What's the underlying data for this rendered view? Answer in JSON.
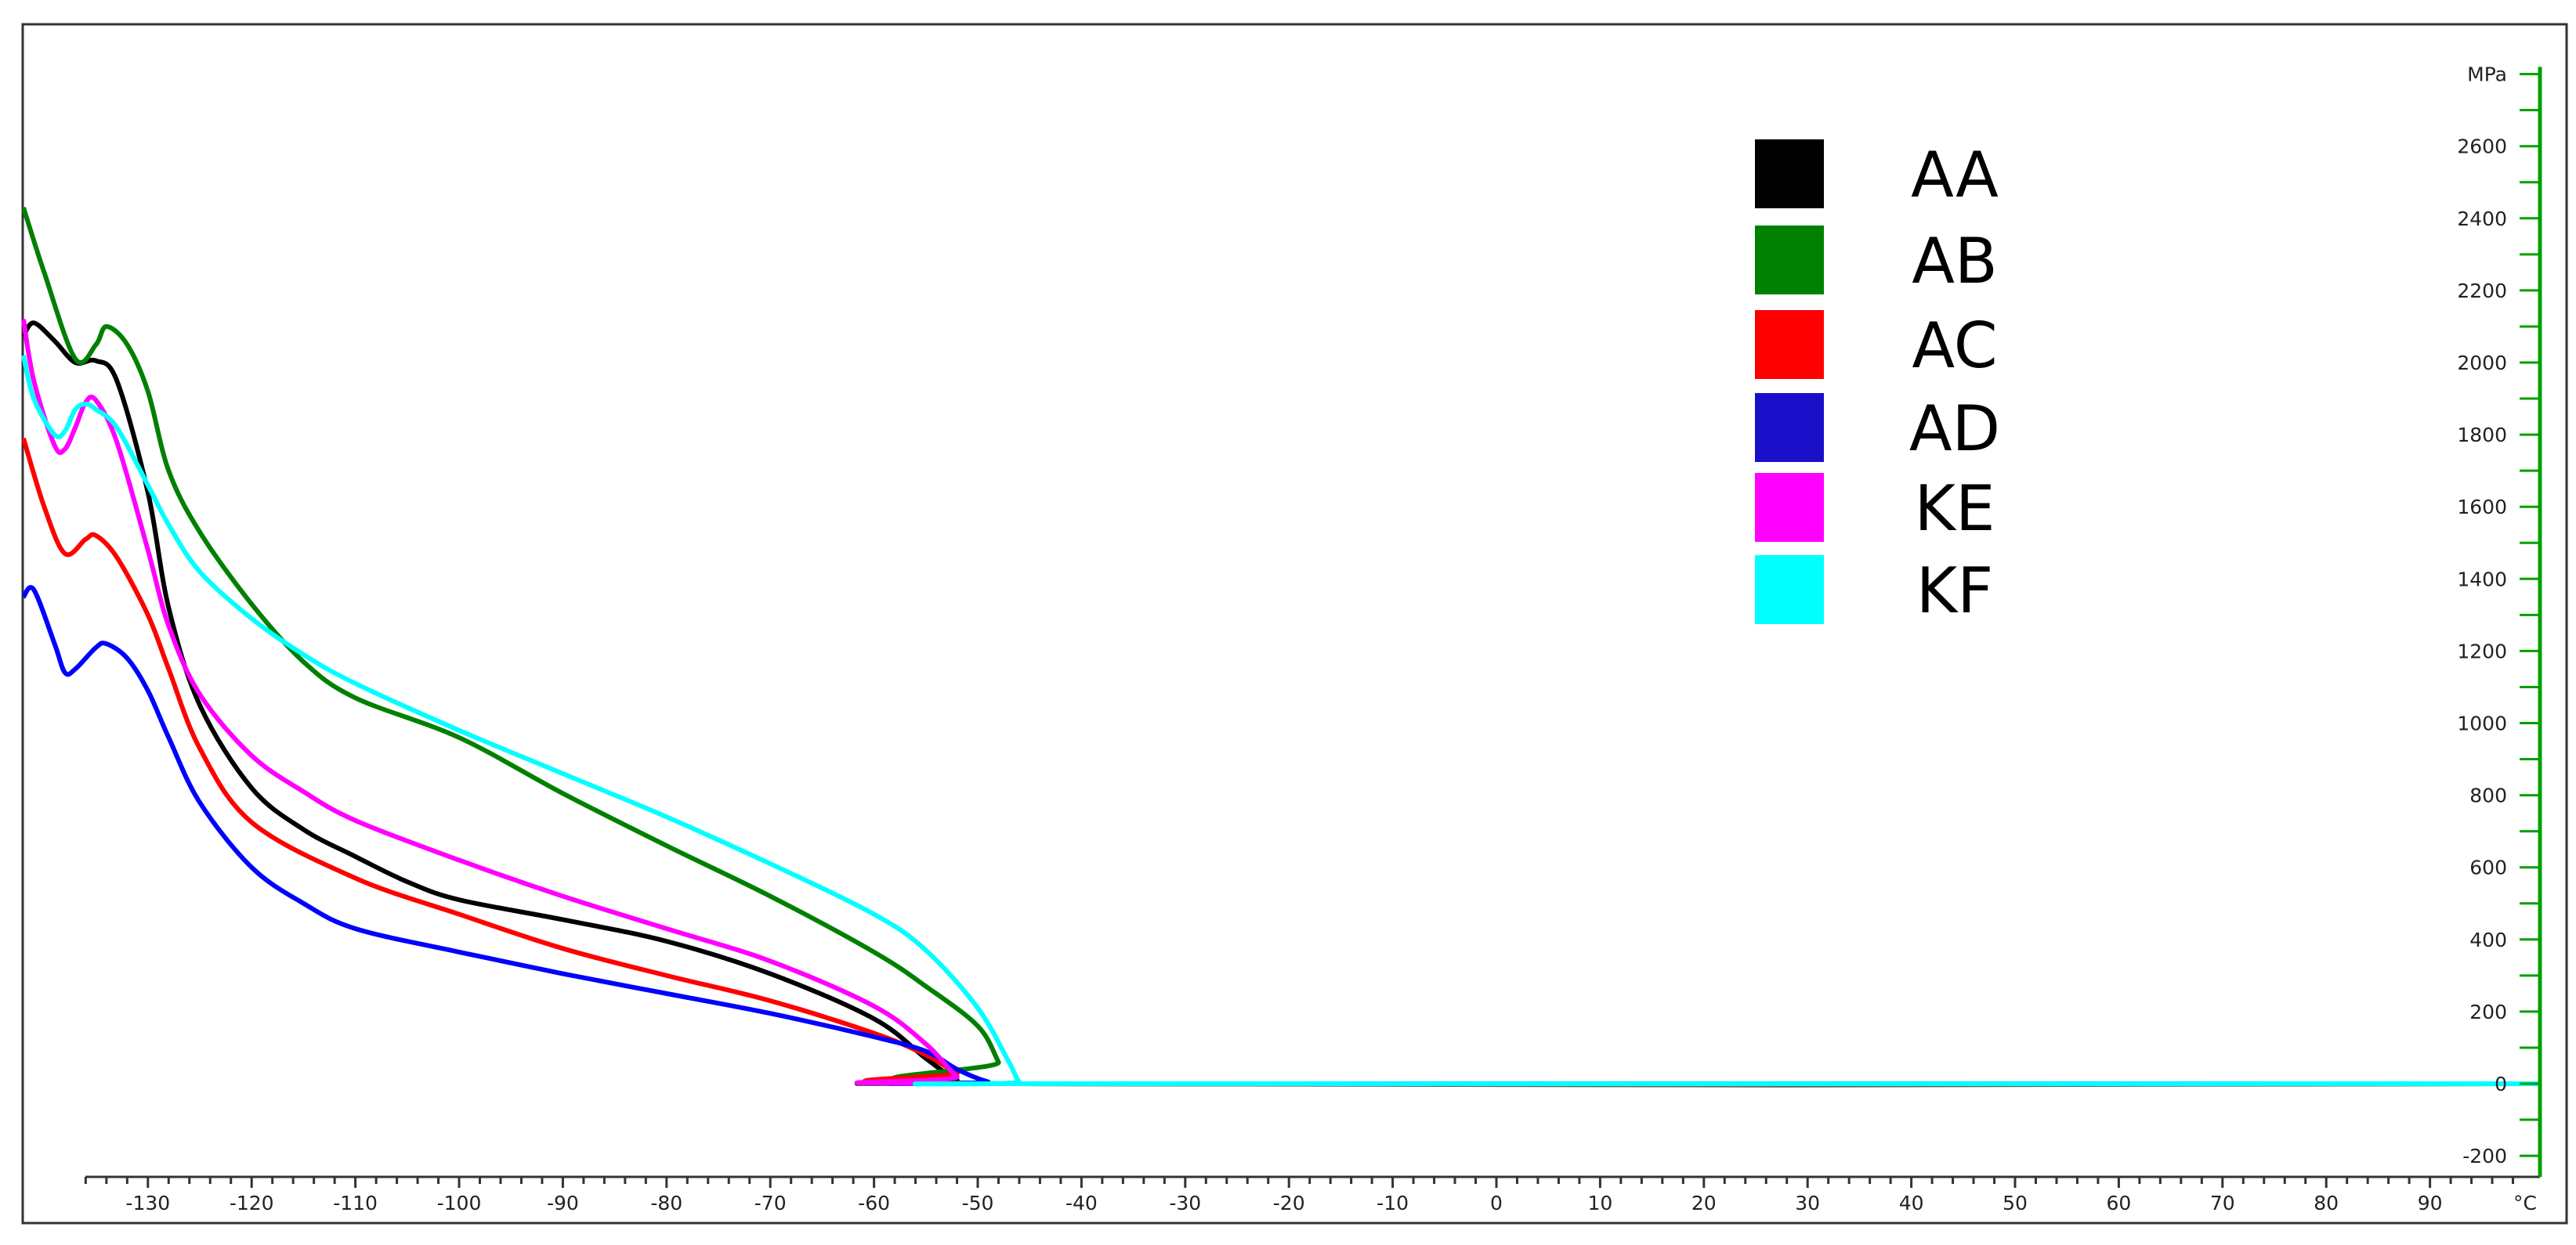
{
  "chart_data": {
    "type": "line",
    "title": "",
    "xlabel": "°C",
    "ylabel": "MPa",
    "xlim": [
      -142,
      100.6
    ],
    "ylim": [
      -250,
      2820
    ],
    "x_ticks": [
      -130,
      -120,
      -110,
      -100,
      -90,
      -80,
      -70,
      -60,
      -50,
      -40,
      -30,
      -20,
      -10,
      0,
      10,
      20,
      30,
      40,
      50,
      60,
      70,
      80,
      90
    ],
    "y_ticks": [
      -200,
      0,
      200,
      400,
      600,
      800,
      1000,
      1200,
      1400,
      1600,
      1800,
      2000,
      2200,
      2400,
      2600
    ],
    "grid": false,
    "legend_position": "top-right",
    "series": [
      {
        "name": "AA",
        "color": "#000000",
        "legend_color": "#000000",
        "x": [
          -142,
          -141,
          -139,
          -137,
          -135,
          -133,
          -130,
          -128,
          -125,
          -120,
          -115,
          -110,
          -105,
          -100,
          -90,
          -80,
          -70,
          -60,
          -55,
          -52,
          -50,
          100.6
        ],
        "y": [
          2073,
          2110,
          2060,
          2000,
          2005,
          1950,
          1640,
          1320,
          1050,
          820,
          705,
          630,
          560,
          510,
          455,
          395,
          305,
          180,
          70,
          10,
          0,
          0
        ]
      },
      {
        "name": "AB",
        "color": "#008000",
        "legend_color": "#008000",
        "x": [
          -142,
          -140,
          -137,
          -135,
          -134,
          -132,
          -130,
          -128,
          -125,
          -120,
          -115,
          -110,
          -100,
          -90,
          -80,
          -70,
          -60,
          -55,
          -50,
          -48,
          -47,
          100.6
        ],
        "y": [
          2430,
          2250,
          2010,
          2050,
          2100,
          2050,
          1920,
          1700,
          1530,
          1330,
          1170,
          1070,
          960,
          805,
          660,
          520,
          365,
          270,
          160,
          60,
          0,
          0
        ]
      },
      {
        "name": "AC",
        "color": "#ff0000",
        "legend_color": "#ff0000",
        "x": [
          -142,
          -140,
          -138,
          -136,
          -135,
          -133,
          -130,
          -128,
          -125,
          -120,
          -110,
          -100,
          -90,
          -80,
          -70,
          -60,
          -55,
          -52,
          -49,
          100.6
        ],
        "y": [
          1790,
          1600,
          1470,
          1510,
          1520,
          1460,
          1300,
          1150,
          930,
          725,
          570,
          470,
          375,
          300,
          230,
          140,
          80,
          30,
          0,
          0
        ]
      },
      {
        "name": "AD",
        "color": "#0000ff",
        "legend_color": "#1a0fc8",
        "x": [
          -142,
          -141,
          -139,
          -138,
          -137,
          -135,
          -134,
          -132,
          -130,
          -128,
          -125,
          -120,
          -115,
          -110,
          -100,
          -90,
          -80,
          -70,
          -60,
          -55,
          -52,
          -49,
          -47,
          100.6
        ],
        "y": [
          1350,
          1370,
          1220,
          1140,
          1150,
          1210,
          1220,
          1180,
          1090,
          960,
          780,
          600,
          500,
          430,
          365,
          305,
          250,
          195,
          130,
          90,
          40,
          5,
          0,
          0
        ]
      },
      {
        "name": "KE",
        "color": "#ff00ff",
        "legend_color": "#ff00ff",
        "x": [
          -142,
          -141,
          -139,
          -138,
          -137,
          -136,
          -135,
          -133,
          -130,
          -128,
          -125,
          -120,
          -115,
          -110,
          -100,
          -90,
          -80,
          -70,
          -60,
          -55,
          -52,
          -50,
          100.6
        ],
        "y": [
          2120,
          1950,
          1770,
          1760,
          1820,
          1890,
          1895,
          1780,
          1480,
          1270,
          1080,
          910,
          810,
          730,
          620,
          520,
          430,
          340,
          215,
          110,
          20,
          0,
          0
        ]
      },
      {
        "name": "KF",
        "color": "#00ffff",
        "legend_color": "#00ffff",
        "x": [
          -142,
          -141,
          -139,
          -138,
          -137,
          -136,
          -135,
          -133,
          -130,
          -128,
          -125,
          -120,
          -115,
          -110,
          -100,
          -90,
          -80,
          -70,
          -60,
          -55,
          -50,
          -47,
          -46,
          -45,
          100.6
        ],
        "y": [
          2020,
          1900,
          1800,
          1810,
          1870,
          1885,
          1870,
          1820,
          1660,
          1550,
          1420,
          1290,
          1190,
          1110,
          980,
          860,
          740,
          610,
          470,
          370,
          210,
          60,
          5,
          0,
          0
        ]
      }
    ]
  }
}
